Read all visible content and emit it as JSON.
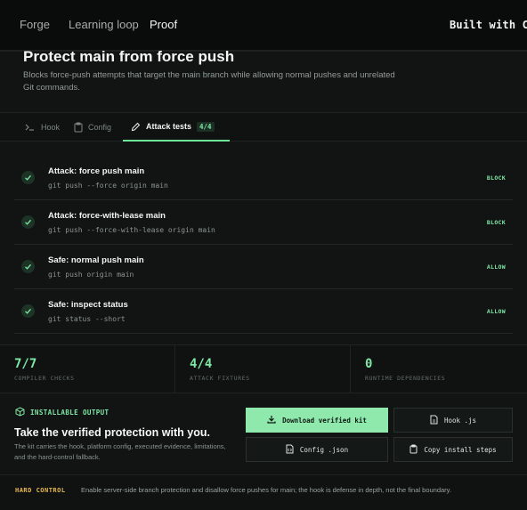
{
  "nav": {
    "items": [
      {
        "label": "Forge"
      },
      {
        "label": "Learning loop"
      },
      {
        "label": "Proof"
      }
    ],
    "active": "Proof",
    "brand": "Built with Code"
  },
  "hook": {
    "title": "Protect main from force push",
    "description": "Blocks force-push attempts that target the main branch while allowing normal pushes and unrelated Git commands."
  },
  "tabs": [
    {
      "label": "Hook",
      "icon": "terminal-icon"
    },
    {
      "label": "Config",
      "icon": "clipboard-icon"
    },
    {
      "label": "Attack tests",
      "icon": "pencil-icon",
      "count": "4/4",
      "active": true
    }
  ],
  "tests": [
    {
      "name": "Attack: force push main",
      "command": "git push --force origin main",
      "verdict": "BLOCK"
    },
    {
      "name": "Attack: force-with-lease main",
      "command": "git push --force-with-lease origin main",
      "verdict": "BLOCK"
    },
    {
      "name": "Safe: normal push main",
      "command": "git push origin main",
      "verdict": "ALLOW"
    },
    {
      "name": "Safe: inspect status",
      "command": "git status --short",
      "verdict": "ALLOW"
    }
  ],
  "stats": [
    {
      "value": "7/7",
      "label": "COMPILER CHECKS"
    },
    {
      "value": "4/4",
      "label": "ATTACK FIXTURES"
    },
    {
      "value": "0",
      "label": "RUNTIME DEPENDENCIES"
    }
  ],
  "installable": {
    "tag": "INSTALLABLE OUTPUT",
    "title": "Take the verified protection with you.",
    "description": "The kit carries the hook, platform config, executed evidence, limitations, and the hard-control fallback.",
    "buttons": {
      "download": "Download verified kit",
      "hook": "Hook .js",
      "config": "Config .json",
      "copy": "Copy install steps"
    }
  },
  "hard_control": {
    "tag": "HARD CONTROL",
    "text": "Enable server-side branch protection and disallow force pushes for main; the hook is defense in depth, not the final boundary."
  },
  "colors": {
    "accent": "#7fe8a6",
    "warning": "#e9b84f",
    "background": "#0b0d0c"
  }
}
